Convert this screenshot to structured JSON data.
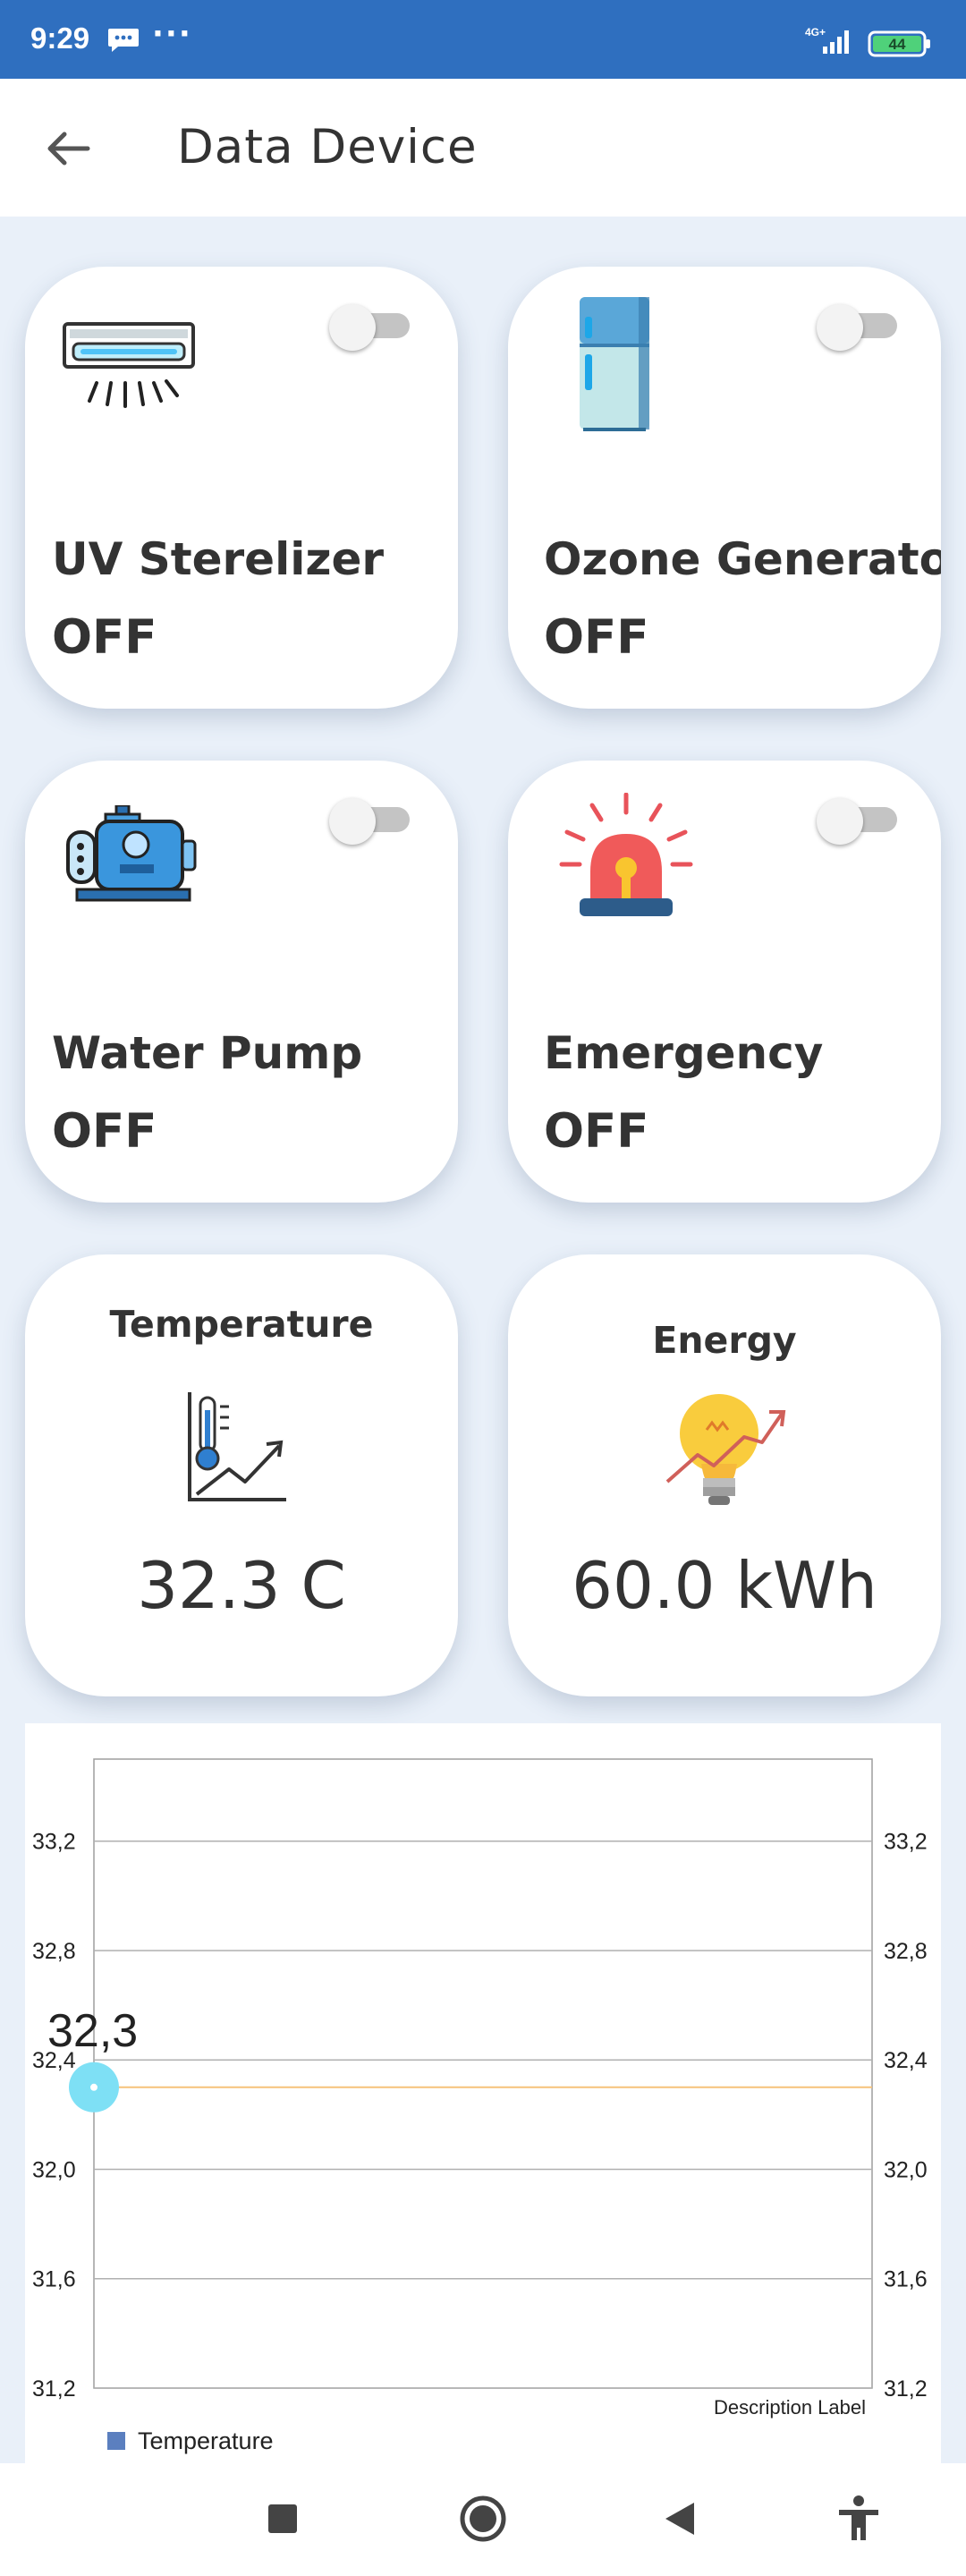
{
  "status_bar": {
    "time": "9:29",
    "icons": [
      "message-icon",
      "more-dots-icon",
      "network-4g-icon",
      "battery-icon"
    ],
    "battery_level": "44",
    "network": "4G+"
  },
  "app_bar": {
    "title": "Data Device",
    "back_icon": "arrow-left-icon"
  },
  "devices": [
    {
      "name": "UV Sterelizer",
      "state": "OFF",
      "icon": "uv-sterilizer-icon",
      "toggle_on": false
    },
    {
      "name": "Ozone Generator",
      "state": "OFF",
      "icon": "refrigerator-icon",
      "toggle_on": false
    },
    {
      "name": "Water Pump",
      "state": "OFF",
      "icon": "water-pump-icon",
      "toggle_on": false
    },
    {
      "name": "Emergency",
      "state": "OFF",
      "icon": "siren-icon",
      "toggle_on": false
    }
  ],
  "sensors": [
    {
      "title": "Temperature",
      "value": "32.3 C",
      "icon": "temperature-chart-icon"
    },
    {
      "title": "Energy",
      "value": "60.0 kWh",
      "icon": "lightbulb-trend-icon"
    }
  ],
  "chart_data": {
    "type": "line",
    "x": [
      0
    ],
    "series": [
      {
        "name": "Temperature",
        "values": [
          32.3
        ]
      }
    ],
    "point_label": "32,3",
    "y_ticks": [
      "33,2",
      "32,8",
      "32,4",
      "32,0",
      "31,6",
      "31,2"
    ],
    "ylim": [
      31.2,
      33.5
    ],
    "description_label": "Description Label",
    "legend_label": "Temperature",
    "grid": true,
    "legend_placement": "bottom-left",
    "colors": {
      "line": "#f5c27a",
      "point": "#7ee0f5",
      "legend": "#5b7fbf"
    }
  },
  "nav_bar": {
    "icons": [
      "recent-apps-icon",
      "home-icon",
      "back-icon",
      "accessibility-icon"
    ]
  },
  "colors": {
    "status_bar": "#2f6fbf",
    "background": "#e9f0f9",
    "card": "#ffffff",
    "text": "#333333"
  }
}
